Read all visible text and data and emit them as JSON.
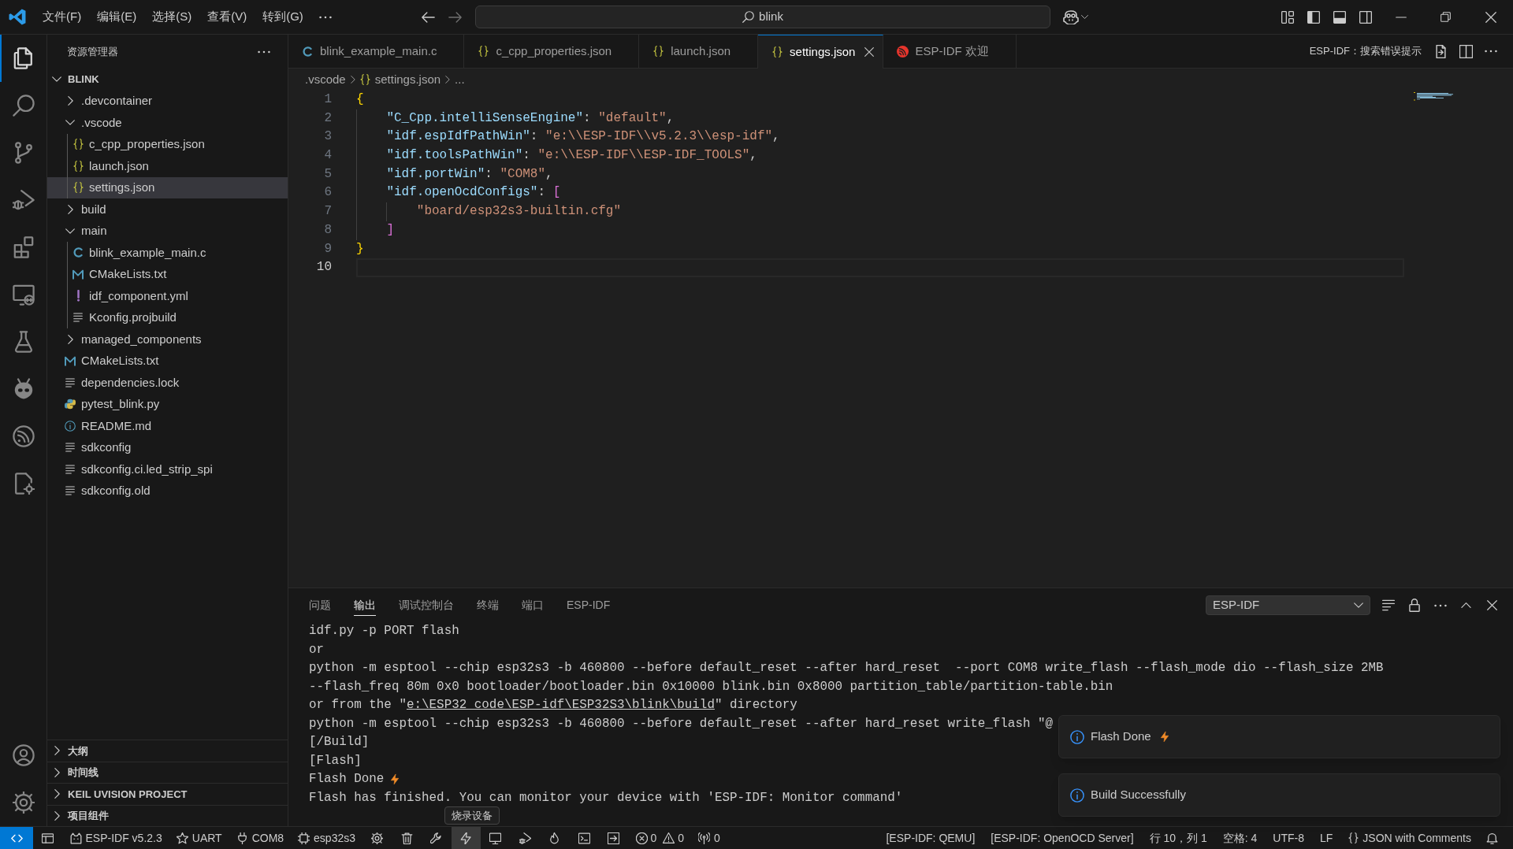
{
  "title_bar": {
    "menus": [
      "文件(F)",
      "编辑(E)",
      "选择(S)",
      "查看(V)",
      "转到(G)"
    ],
    "search": {
      "value": "blink"
    }
  },
  "activity_bar": {
    "items": [
      {
        "kind": "explorer",
        "selected": true
      },
      {
        "kind": "search",
        "selected": false
      },
      {
        "kind": "source_control",
        "selected": false
      },
      {
        "kind": "run_debug",
        "selected": false
      },
      {
        "kind": "extensions",
        "selected": false
      },
      {
        "kind": "remote",
        "selected": false
      },
      {
        "kind": "testing",
        "selected": false
      },
      {
        "kind": "platformio",
        "selected": false
      },
      {
        "kind": "espidf",
        "selected": false
      },
      {
        "kind": "cpp_config",
        "selected": false
      }
    ],
    "bottom": [
      {
        "kind": "account"
      },
      {
        "kind": "manage"
      }
    ]
  },
  "sidebar": {
    "title": "资源管理器",
    "root": {
      "label": "BLINK",
      "expanded": true
    },
    "tree": [
      {
        "label": ".devcontainer",
        "kind": "folder",
        "expanded": false,
        "selected": false
      },
      {
        "label": ".vscode",
        "kind": "folder",
        "expanded": true,
        "selected": false,
        "children": [
          {
            "label": "c_cpp_properties.json",
            "kind": "json",
            "selected": false
          },
          {
            "label": "launch.json",
            "kind": "json",
            "selected": false
          },
          {
            "label": "settings.json",
            "kind": "json",
            "selected": true
          }
        ]
      },
      {
        "label": "build",
        "kind": "folder",
        "expanded": false,
        "selected": false
      },
      {
        "label": "main",
        "kind": "folder",
        "expanded": true,
        "selected": false,
        "children": [
          {
            "label": "blink_example_main.c",
            "kind": "c",
            "selected": false
          },
          {
            "label": "CMakeLists.txt",
            "kind": "cmake",
            "selected": false
          },
          {
            "label": "idf_component.yml",
            "kind": "yaml",
            "selected": false
          },
          {
            "label": "Kconfig.projbuild",
            "kind": "text",
            "selected": false
          }
        ]
      },
      {
        "label": "managed_components",
        "kind": "folder",
        "expanded": false,
        "selected": false
      },
      {
        "label": "CMakeLists.txt",
        "kind": "cmake",
        "selected": false
      },
      {
        "label": "dependencies.lock",
        "kind": "text",
        "selected": false
      },
      {
        "label": "pytest_blink.py",
        "kind": "python",
        "selected": false
      },
      {
        "label": "README.md",
        "kind": "info",
        "selected": false
      },
      {
        "label": "sdkconfig",
        "kind": "text",
        "selected": false
      },
      {
        "label": "sdkconfig.ci.led_strip_spi",
        "kind": "text",
        "selected": false
      },
      {
        "label": "sdkconfig.old",
        "kind": "text",
        "selected": false
      }
    ],
    "sections": [
      {
        "label": "大纲",
        "expanded": false
      },
      {
        "label": "时间线",
        "expanded": false
      },
      {
        "label": "KEIL UVISION PROJECT",
        "expanded": false
      },
      {
        "label": "项目组件",
        "expanded": false
      }
    ]
  },
  "editor": {
    "tabs": [
      {
        "label": "blink_example_main.c",
        "kind": "c",
        "selected": false
      },
      {
        "label": "c_cpp_properties.json",
        "kind": "json",
        "selected": false
      },
      {
        "label": "launch.json",
        "kind": "json",
        "selected": false
      },
      {
        "label": "settings.json",
        "kind": "json",
        "selected": true
      },
      {
        "label": "ESP-IDF 欢迎",
        "kind": "espressif",
        "selected": false
      }
    ],
    "action_label": "ESP-IDF：搜索错误提示",
    "breadcrumbs": [
      {
        "label": ".vscode",
        "kind": "folder"
      },
      {
        "label": "settings.json",
        "kind": "json"
      },
      {
        "label": "...",
        "kind": "more"
      }
    ],
    "lines": [
      {
        "number": "1",
        "current": false,
        "tokens": [
          {
            "kind": "brace",
            "text": "{"
          }
        ]
      },
      {
        "number": "2",
        "current": false,
        "tokens": [
          {
            "kind": "key",
            "text": "    \"C_Cpp.intelliSenseEngine\""
          },
          {
            "kind": "punct",
            "text": ": "
          },
          {
            "kind": "string",
            "text": "\"default\""
          },
          {
            "kind": "punct",
            "text": ","
          }
        ]
      },
      {
        "number": "3",
        "current": false,
        "tokens": [
          {
            "kind": "key",
            "text": "    \"idf.espIdfPathWin\""
          },
          {
            "kind": "punct",
            "text": ": "
          },
          {
            "kind": "string",
            "text": "\"e:\\\\ESP-IDF\\\\v5.2.3\\\\esp-idf\""
          },
          {
            "kind": "punct",
            "text": ","
          }
        ]
      },
      {
        "number": "4",
        "current": false,
        "tokens": [
          {
            "kind": "key",
            "text": "    \"idf.toolsPathWin\""
          },
          {
            "kind": "punct",
            "text": ": "
          },
          {
            "kind": "string",
            "text": "\"e:\\\\ESP-IDF\\\\ESP-IDF_TOOLS\""
          },
          {
            "kind": "punct",
            "text": ","
          }
        ]
      },
      {
        "number": "5",
        "current": false,
        "tokens": [
          {
            "kind": "key",
            "text": "    \"idf.portWin\""
          },
          {
            "kind": "punct",
            "text": ": "
          },
          {
            "kind": "string",
            "text": "\"COM8\""
          },
          {
            "kind": "punct",
            "text": ","
          }
        ]
      },
      {
        "number": "6",
        "current": false,
        "tokens": [
          {
            "kind": "key",
            "text": "    \"idf.openOcdConfigs\""
          },
          {
            "kind": "punct",
            "text": ": "
          },
          {
            "kind": "bracket",
            "text": "["
          }
        ]
      },
      {
        "number": "7",
        "current": false,
        "tokens": [
          {
            "kind": "string",
            "text": "        \"board/esp32s3-builtin.cfg\""
          }
        ]
      },
      {
        "number": "8",
        "current": false,
        "tokens": [
          {
            "kind": "bracket",
            "text": "    ]"
          }
        ]
      },
      {
        "number": "9",
        "current": false,
        "tokens": [
          {
            "kind": "brace",
            "text": "}"
          }
        ]
      },
      {
        "number": "10",
        "current": true
      }
    ]
  },
  "panel": {
    "tabs": [
      {
        "label": "问题",
        "selected": false
      },
      {
        "label": "输出",
        "selected": true
      },
      {
        "label": "调试控制台",
        "selected": false
      },
      {
        "label": "终端",
        "selected": false
      },
      {
        "label": "端口",
        "selected": false
      },
      {
        "label": "ESP-IDF",
        "selected": false
      }
    ],
    "channel": "ESP-IDF",
    "output": [
      {
        "kind": "plain",
        "text": "idf.py -p PORT flash"
      },
      {
        "kind": "plain",
        "text": "or"
      },
      {
        "kind": "plain",
        "text": "python -m esptool --chip esp32s3 -b 460800 --before default_reset --after hard_reset  --port COM8 write_flash --flash_mode dio --flash_size 2MB"
      },
      {
        "kind": "plain",
        "text": "--flash_freq 80m 0x0 bootloader/bootloader.bin 0x10000 blink.bin 0x8000 partition_table/partition-table.bin"
      },
      {
        "kind": "link",
        "before": "or from the \"",
        "link": "e:\\ESP32_code\\ESP-idf\\ESP32S3\\blink\\build",
        "after": "\" directory"
      },
      {
        "kind": "plain",
        "text": "python -m esptool --chip esp32s3 -b 460800 --before default_reset --after hard_reset write_flash \"@"
      },
      {
        "kind": "plain",
        "text": "[/Build]"
      },
      {
        "kind": "plain",
        "text": "[Flash]"
      },
      {
        "kind": "bolt",
        "text": "Flash Done"
      },
      {
        "kind": "plain",
        "text": "Flash has finished. You can monitor your device with 'ESP-IDF: Monitor command'"
      }
    ],
    "notifications": [
      {
        "message": "Flash Done",
        "kind": "bolt"
      },
      {
        "message": "Build Successfully",
        "kind": "plain"
      }
    ]
  },
  "status_bar": {
    "left": [
      {
        "kind": "remote",
        "hovered": false
      },
      {
        "kind": "window",
        "hovered": false
      },
      {
        "kind": "cat",
        "label": "ESP-IDF v5.2.3",
        "hovered": false
      },
      {
        "kind": "star",
        "label": "UART",
        "hovered": false
      },
      {
        "kind": "plug",
        "label": "COM8",
        "hovered": false
      },
      {
        "kind": "chip",
        "label": "esp32s3",
        "hovered": false
      },
      {
        "kind": "gear",
        "hovered": false
      },
      {
        "kind": "trash",
        "hovered": false
      },
      {
        "kind": "wrench",
        "hovered": false
      },
      {
        "kind": "bolt",
        "hovered": true,
        "tooltip": "烧录设备"
      },
      {
        "kind": "monitor",
        "hovered": false
      },
      {
        "kind": "debug",
        "hovered": false
      },
      {
        "kind": "flame",
        "hovered": false
      },
      {
        "kind": "terminal",
        "hovered": false
      },
      {
        "kind": "export",
        "hovered": false
      },
      {
        "kind": "problems",
        "errors": "0",
        "warnings": "0",
        "hovered": false
      },
      {
        "kind": "antenna",
        "label": "0",
        "hovered": false
      }
    ],
    "right": [
      {
        "kind": "text",
        "label": "[ESP-IDF: QEMU]"
      },
      {
        "kind": "text",
        "label": "[ESP-IDF: OpenOCD Server]"
      },
      {
        "kind": "text",
        "label": "行 10，列 1"
      },
      {
        "kind": "text",
        "label": "空格: 4"
      },
      {
        "kind": "text",
        "label": "UTF-8"
      },
      {
        "kind": "text",
        "label": "LF"
      },
      {
        "kind": "braces",
        "label": "JSON with Comments"
      },
      {
        "kind": "bell"
      }
    ]
  }
}
